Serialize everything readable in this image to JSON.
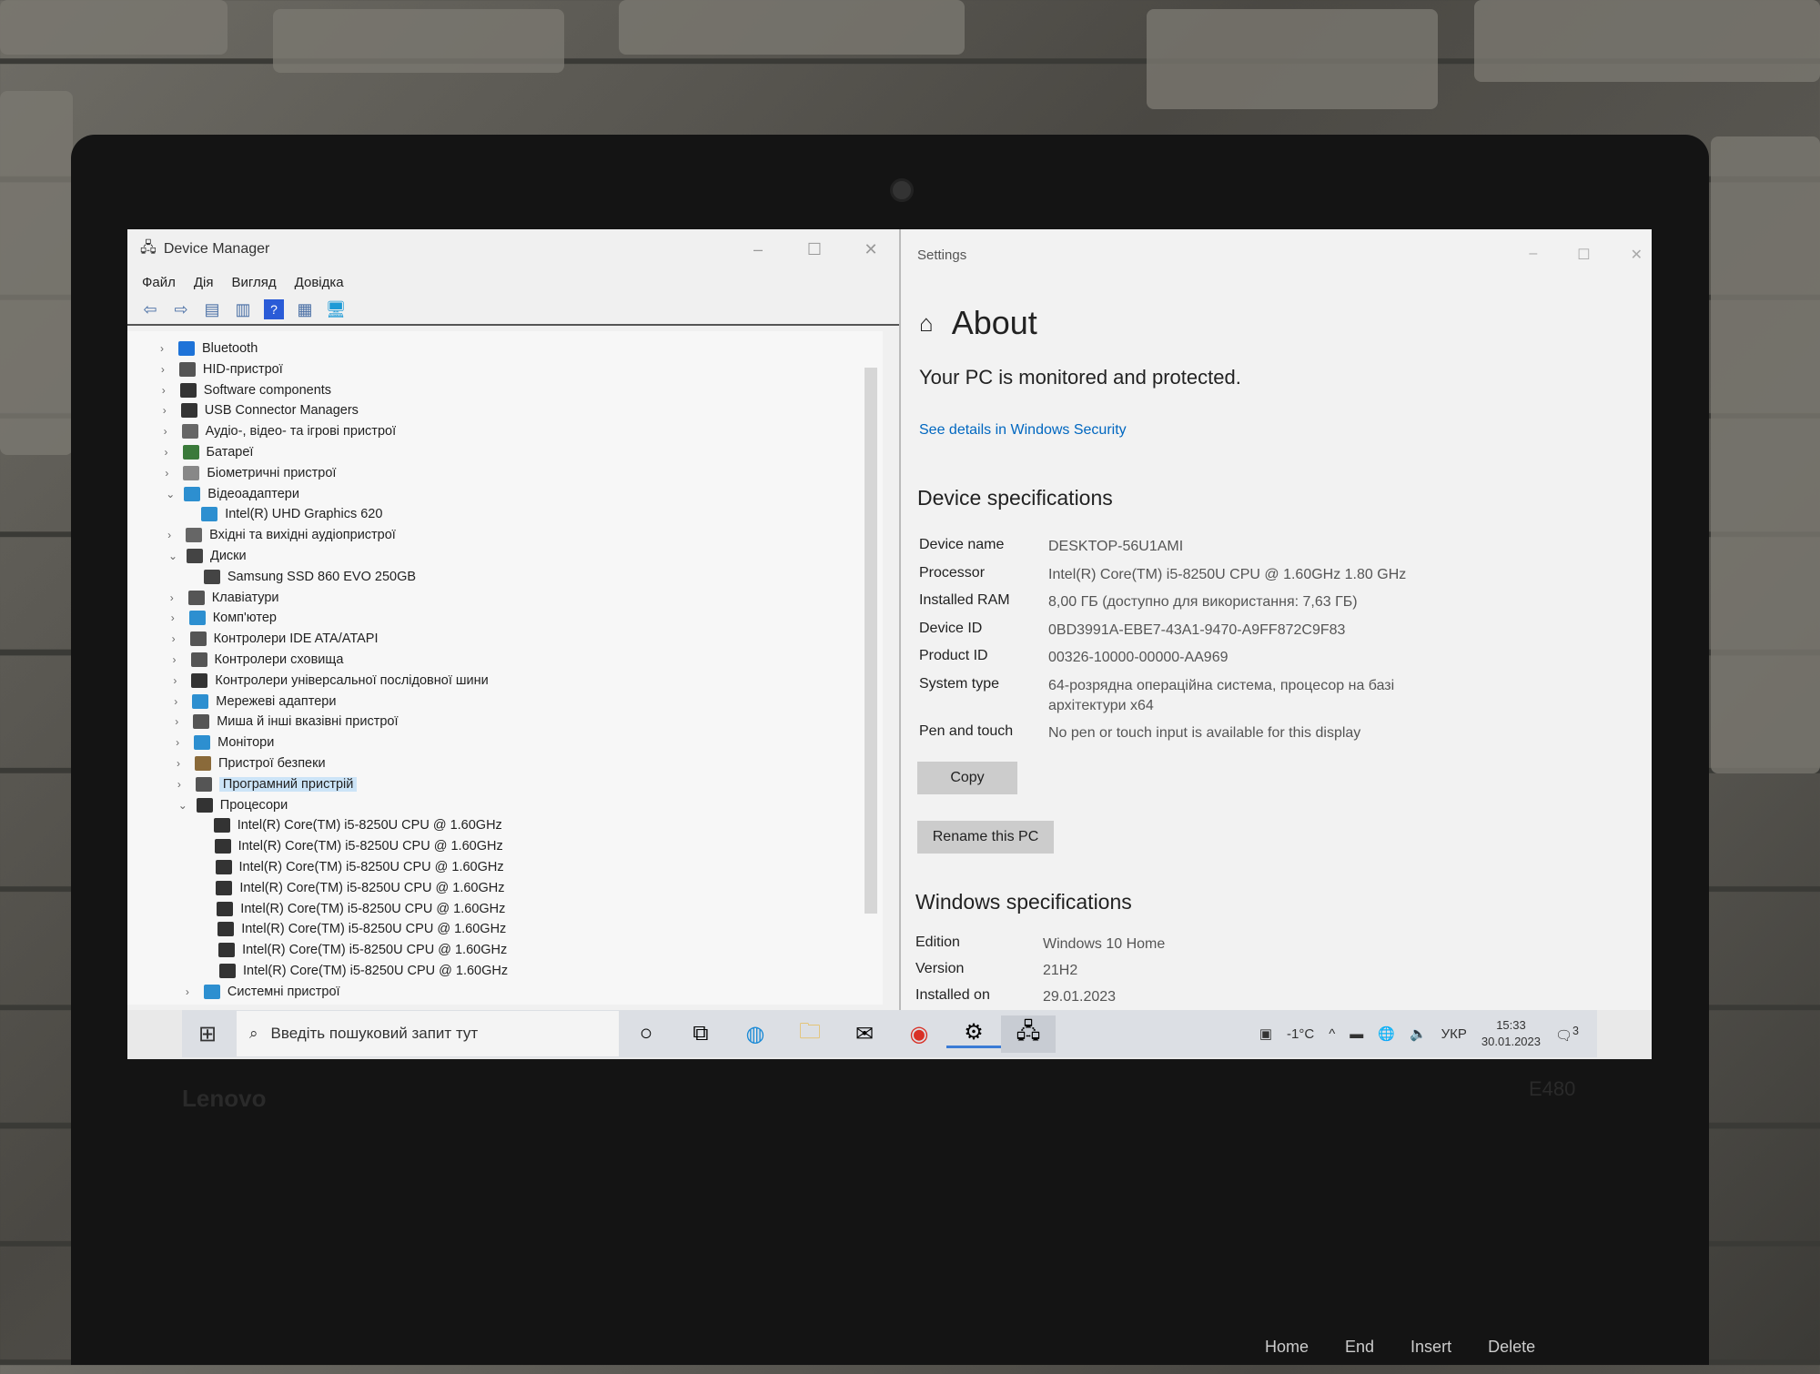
{
  "device_manager": {
    "title": "Device Manager",
    "menu": [
      "Файл",
      "Дія",
      "Вигляд",
      "Довідка"
    ],
    "tree": [
      {
        "label": "Bluetooth",
        "level": 0,
        "expanded": false,
        "icon": "bluetooth-icon",
        "color": "#1e73d8"
      },
      {
        "label": "HID-пристрої",
        "level": 0,
        "expanded": false,
        "icon": "hid-icon",
        "color": "#555"
      },
      {
        "label": "Software components",
        "level": 0,
        "expanded": false,
        "icon": "software-icon",
        "color": "#333"
      },
      {
        "label": "USB Connector Managers",
        "level": 0,
        "expanded": false,
        "icon": "usb-icon",
        "color": "#333"
      },
      {
        "label": "Аудіо-, відео- та ігрові пристрої",
        "level": 0,
        "expanded": false,
        "icon": "speaker-icon",
        "color": "#666"
      },
      {
        "label": "Батареї",
        "level": 0,
        "expanded": false,
        "icon": "battery-icon",
        "color": "#3a7a3a"
      },
      {
        "label": "Біометричні пристрої",
        "level": 0,
        "expanded": false,
        "icon": "biometric-icon",
        "color": "#888"
      },
      {
        "label": "Відеоадаптери",
        "level": 0,
        "expanded": true,
        "icon": "display-adapter-icon",
        "color": "#2d8fd0"
      },
      {
        "label": "Intel(R) UHD Graphics 620",
        "level": 1,
        "icon": "display-adapter-icon",
        "color": "#2d8fd0"
      },
      {
        "label": "Вхідні та вихідні аудіопристрої",
        "level": 0,
        "expanded": false,
        "icon": "speaker-icon",
        "color": "#666"
      },
      {
        "label": "Диски",
        "level": 0,
        "expanded": true,
        "icon": "disk-icon",
        "color": "#444"
      },
      {
        "label": "Samsung SSD 860 EVO 250GB",
        "level": 1,
        "icon": "disk-icon",
        "color": "#444"
      },
      {
        "label": "Клавіатури",
        "level": 0,
        "expanded": false,
        "icon": "keyboard-icon",
        "color": "#555"
      },
      {
        "label": "Комп'ютер",
        "level": 0,
        "expanded": false,
        "icon": "computer-icon",
        "color": "#2d8fd0"
      },
      {
        "label": "Контролери IDE ATA/ATAPI",
        "level": 0,
        "expanded": false,
        "icon": "ide-icon",
        "color": "#555"
      },
      {
        "label": "Контролери сховища",
        "level": 0,
        "expanded": false,
        "icon": "storage-icon",
        "color": "#555"
      },
      {
        "label": "Контролери універсальної послідовної шини",
        "level": 0,
        "expanded": false,
        "icon": "usb-icon",
        "color": "#333"
      },
      {
        "label": "Мережеві адаптери",
        "level": 0,
        "expanded": false,
        "icon": "network-icon",
        "color": "#2d8fd0"
      },
      {
        "label": "Миша й інші вказівні пристрої",
        "level": 0,
        "expanded": false,
        "icon": "mouse-icon",
        "color": "#555"
      },
      {
        "label": "Монітори",
        "level": 0,
        "expanded": false,
        "icon": "monitor-icon",
        "color": "#2d8fd0"
      },
      {
        "label": "Пристрої безпеки",
        "level": 0,
        "expanded": false,
        "icon": "security-icon",
        "color": "#8a6a3a"
      },
      {
        "label": "Програмний пристрій",
        "level": 0,
        "expanded": false,
        "icon": "software-device-icon",
        "color": "#555",
        "selected": true
      },
      {
        "label": "Процесори",
        "level": 0,
        "expanded": true,
        "icon": "processor-icon",
        "color": "#333"
      },
      {
        "label": "Intel(R) Core(TM) i5-8250U CPU @ 1.60GHz",
        "level": 1,
        "icon": "processor-icon",
        "color": "#333"
      },
      {
        "label": "Intel(R) Core(TM) i5-8250U CPU @ 1.60GHz",
        "level": 1,
        "icon": "processor-icon",
        "color": "#333"
      },
      {
        "label": "Intel(R) Core(TM) i5-8250U CPU @ 1.60GHz",
        "level": 1,
        "icon": "processor-icon",
        "color": "#333"
      },
      {
        "label": "Intel(R) Core(TM) i5-8250U CPU @ 1.60GHz",
        "level": 1,
        "icon": "processor-icon",
        "color": "#333"
      },
      {
        "label": "Intel(R) Core(TM) i5-8250U CPU @ 1.60GHz",
        "level": 1,
        "icon": "processor-icon",
        "color": "#333"
      },
      {
        "label": "Intel(R) Core(TM) i5-8250U CPU @ 1.60GHz",
        "level": 1,
        "icon": "processor-icon",
        "color": "#333"
      },
      {
        "label": "Intel(R) Core(TM) i5-8250U CPU @ 1.60GHz",
        "level": 1,
        "icon": "processor-icon",
        "color": "#333"
      },
      {
        "label": "Intel(R) Core(TM) i5-8250U CPU @ 1.60GHz",
        "level": 1,
        "icon": "processor-icon",
        "color": "#333"
      },
      {
        "label": "Системні пристрої",
        "level": 0,
        "expanded": false,
        "icon": "system-icon",
        "color": "#2d8fd0"
      }
    ]
  },
  "settings": {
    "window_title": "Settings",
    "page_title": "About",
    "protected": "Your PC is monitored and protected.",
    "security_link": "See details in Windows Security",
    "device_specs_heading": "Device specifications",
    "device_specs": [
      {
        "label": "Device name",
        "value": "DESKTOP-56U1AMI"
      },
      {
        "label": "Processor",
        "value": "Intel(R) Core(TM) i5-8250U CPU @ 1.60GHz   1.80 GHz"
      },
      {
        "label": "Installed RAM",
        "value": "8,00 ГБ (доступно для використання: 7,63 ГБ)"
      },
      {
        "label": "Device ID",
        "value": "0BD3991A-EBE7-43A1-9470-A9FF872C9F83"
      },
      {
        "label": "Product ID",
        "value": "00326-10000-00000-AA969"
      },
      {
        "label": "System type",
        "value": "64-розрядна операційна система, процесор на базі архітектури x64"
      },
      {
        "label": "Pen and touch",
        "value": "No pen or touch input is available for this display"
      }
    ],
    "copy_label": "Copy",
    "rename_label": "Rename this PC",
    "windows_specs_heading": "Windows specifications",
    "windows_specs": [
      {
        "label": "Edition",
        "value": "Windows 10 Home"
      },
      {
        "label": "Version",
        "value": "21H2"
      },
      {
        "label": "Installed on",
        "value": "29.01.2023"
      }
    ],
    "link_color": "#0067c0"
  },
  "taskbar": {
    "search_placeholder": "Введіть пошуковий запит тут",
    "weather": "-1°C",
    "language": "УКР",
    "time": "15:33",
    "date": "30.01.2023",
    "notifications": "3"
  },
  "laptop": {
    "brand": "Lenovo",
    "model": "E480",
    "keys": [
      "Home",
      "End",
      "Insert",
      "Delete"
    ]
  }
}
